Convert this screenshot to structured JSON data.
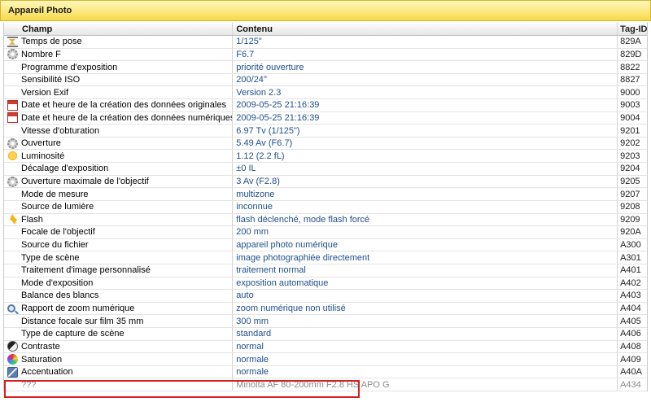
{
  "panel": {
    "title": "Appareil Photo"
  },
  "table": {
    "headers": {
      "field": "Champ",
      "value": "Contenu",
      "tag": "Tag-ID"
    },
    "rows": [
      {
        "field": "Temps de pose",
        "value": "1/125\"",
        "tag": "829A",
        "icon": "hourglass-icon"
      },
      {
        "field": "Nombre F",
        "value": "F6.7",
        "tag": "829D",
        "icon": "aperture-icon"
      },
      {
        "field": "Programme d'exposition",
        "value": "priorité ouverture",
        "tag": "8822",
        "icon": ""
      },
      {
        "field": "Sensibilité ISO",
        "value": "200/24°",
        "tag": "8827",
        "icon": ""
      },
      {
        "field": "Version Exif",
        "value": "Version 2.3",
        "tag": "9000",
        "icon": ""
      },
      {
        "field": "Date et heure de la création des données originales",
        "value": "2009-05-25 21:16:39",
        "tag": "9003",
        "icon": "calendar-icon"
      },
      {
        "field": "Date et heure de la création des données numériques",
        "value": "2009-05-25 21:16:39",
        "tag": "9004",
        "icon": "calendar-icon"
      },
      {
        "field": "Vitesse d'obturation",
        "value": "6.97 Tv (1/125\")",
        "tag": "9201",
        "icon": ""
      },
      {
        "field": "Ouverture",
        "value": "5.49 Av (F6.7)",
        "tag": "9202",
        "icon": "aperture-icon"
      },
      {
        "field": "Luminosité",
        "value": "1.12 (2.2 fL)",
        "tag": "9203",
        "icon": "sun-icon"
      },
      {
        "field": "Décalage d'exposition",
        "value": "±0 IL",
        "tag": "9204",
        "icon": ""
      },
      {
        "field": "Ouverture maximale de l'objectif",
        "value": "3 Av (F2.8)",
        "tag": "9205",
        "icon": "aperture-icon"
      },
      {
        "field": "Mode de mesure",
        "value": "multizone",
        "tag": "9207",
        "icon": ""
      },
      {
        "field": "Source de lumière",
        "value": "inconnue",
        "tag": "9208",
        "icon": ""
      },
      {
        "field": "Flash",
        "value": "flash déclenché, mode flash forcé",
        "tag": "9209",
        "icon": "flash-icon"
      },
      {
        "field": "Focale de l'objectif",
        "value": "200 mm",
        "tag": "920A",
        "icon": ""
      },
      {
        "field": "Source du fichier",
        "value": "appareil photo numérique",
        "tag": "A300",
        "icon": ""
      },
      {
        "field": "Type de scène",
        "value": "image photographiée directement",
        "tag": "A301",
        "icon": ""
      },
      {
        "field": "Traitement d'image personnalisé",
        "value": "traitement normal",
        "tag": "A401",
        "icon": ""
      },
      {
        "field": "Mode d'exposition",
        "value": "exposition automatique",
        "tag": "A402",
        "icon": ""
      },
      {
        "field": "Balance des blancs",
        "value": "auto",
        "tag": "A403",
        "icon": ""
      },
      {
        "field": "Rapport de zoom numérique",
        "value": "zoom numérique non utilisé",
        "tag": "A404",
        "icon": "zoom-icon"
      },
      {
        "field": "Distance focale sur film 35 mm",
        "value": "300 mm",
        "tag": "A405",
        "icon": ""
      },
      {
        "field": "Type de capture de scène",
        "value": "standard",
        "tag": "A406",
        "icon": ""
      },
      {
        "field": "Contraste",
        "value": "normal",
        "tag": "A408",
        "icon": "contrast-icon"
      },
      {
        "field": "Saturation",
        "value": "normale",
        "tag": "A409",
        "icon": "saturation-icon"
      },
      {
        "field": "Accentuation",
        "value": "normale",
        "tag": "A40A",
        "icon": "sharpen-icon"
      },
      {
        "field": "???",
        "value": "Minolta AF 80-200mm F2.8 HS APO G",
        "tag": "A434",
        "icon": ""
      }
    ]
  },
  "colors": {
    "header_bg": "#f8d948",
    "value_text": "#1f4e8c",
    "highlight_border": "#d32020"
  }
}
